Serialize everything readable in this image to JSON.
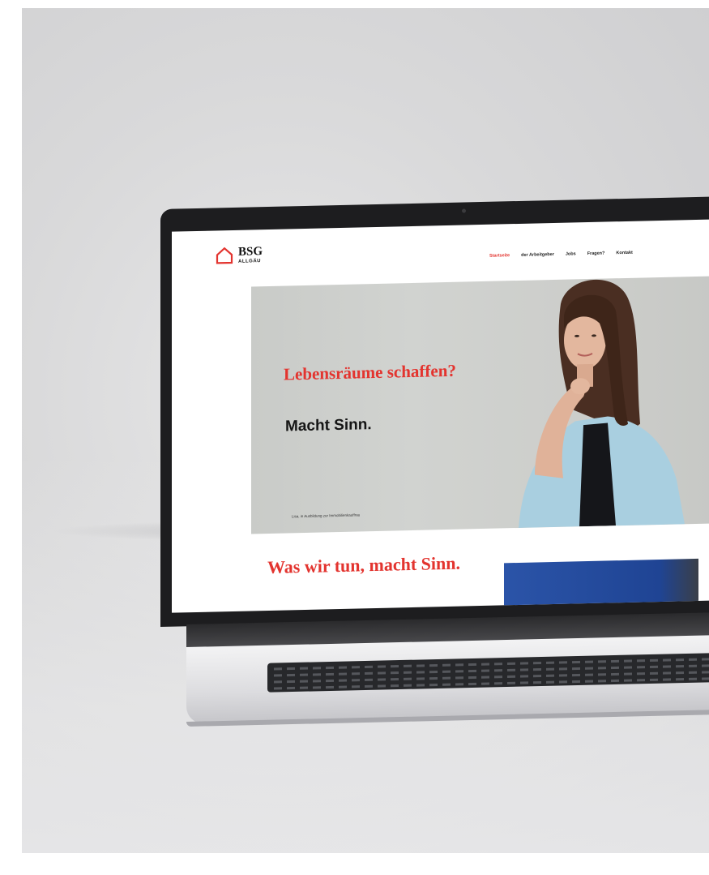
{
  "site": {
    "logo": {
      "main": "BSG",
      "sub": "ALLGÄU"
    },
    "nav": [
      {
        "label": "Startseite",
        "active": true
      },
      {
        "label": "der Arbeitgeber",
        "active": false
      },
      {
        "label": "Jobs",
        "active": false
      },
      {
        "label": "Fragen?",
        "active": false
      },
      {
        "label": "Kontakt",
        "active": false
      }
    ],
    "hero": {
      "title_red": "Lebensräume schaffen?",
      "title_black": "Macht Sinn.",
      "caption": "Lisa, in Ausbildung zur Immobilienkauffrau"
    },
    "section": {
      "title": "Was wir tun, macht Sinn."
    },
    "colors": {
      "accent": "#e3342f",
      "text": "#151515",
      "hero_bg": "#cbccc9"
    }
  }
}
